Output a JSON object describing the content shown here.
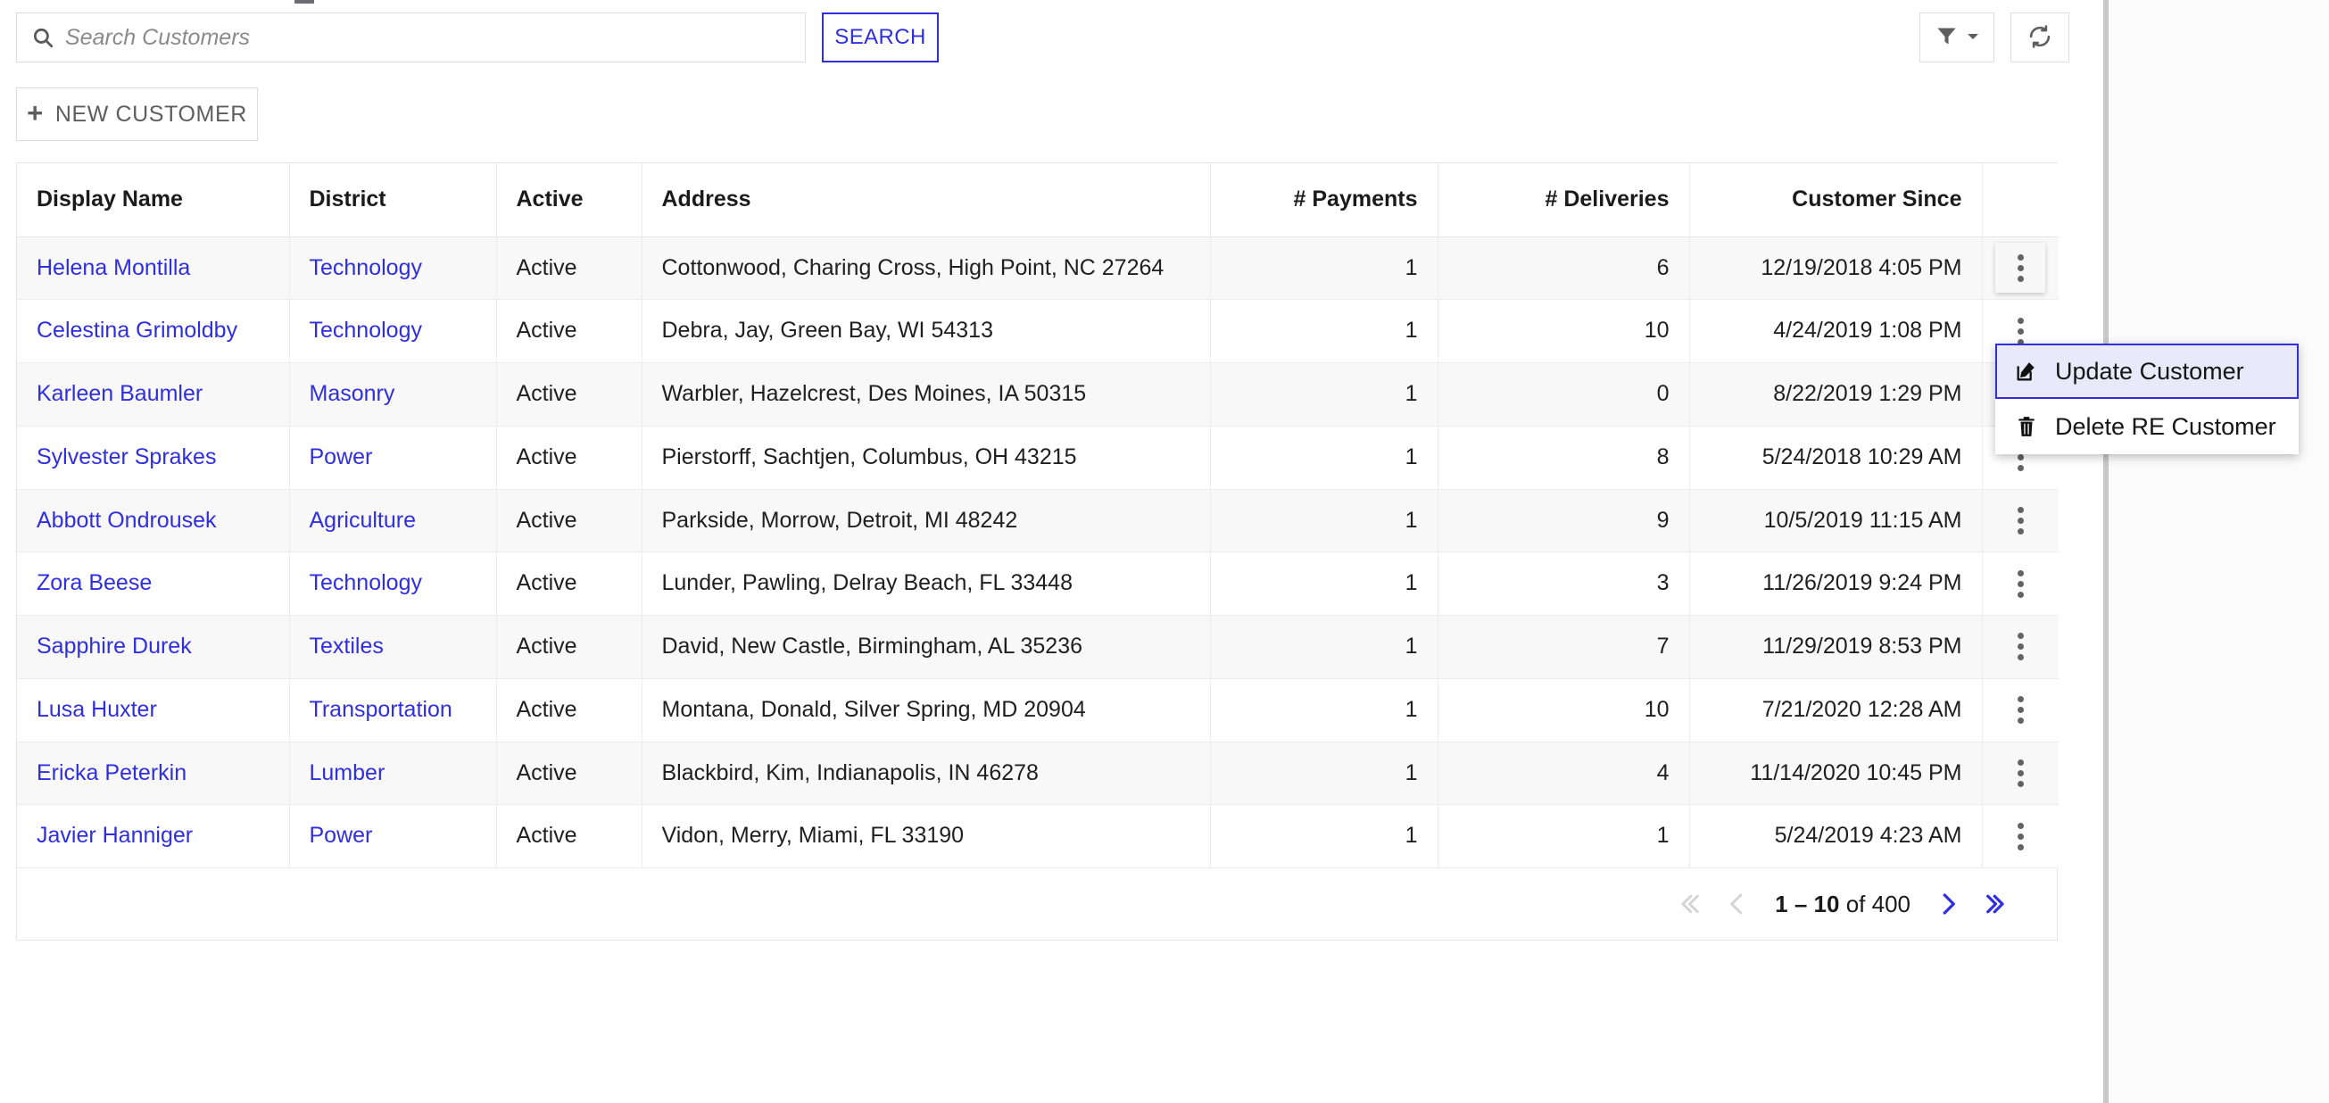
{
  "search": {
    "placeholder": "Search Customers",
    "value": "",
    "button_label": "SEARCH",
    "icon": "search-icon"
  },
  "toolbar": {
    "filter_icon": "filter-funnel-icon",
    "filter_caret_icon": "chevron-down-icon",
    "refresh_icon": "refresh-icon"
  },
  "new_customer": {
    "label": "NEW CUSTOMER",
    "icon": "plus-icon"
  },
  "table": {
    "columns": [
      {
        "label": "Display Name",
        "align": "left"
      },
      {
        "label": "District",
        "align": "left"
      },
      {
        "label": "Active",
        "align": "left"
      },
      {
        "label": "Address",
        "align": "left"
      },
      {
        "label": "# Payments",
        "align": "right"
      },
      {
        "label": "# Deliveries",
        "align": "right"
      },
      {
        "label": "Customer Since",
        "align": "right"
      },
      {
        "label": "",
        "align": "center"
      }
    ],
    "rows": [
      {
        "display_name": "Helena Montilla",
        "district": "Technology",
        "active": "Active",
        "address": "Cottonwood, Charing Cross, High Point, NC 27264",
        "payments": "1",
        "deliveries": "6",
        "customer_since": "12/19/2018 4:05 PM",
        "menu_open": true
      },
      {
        "display_name": "Celestina Grimoldby",
        "district": "Technology",
        "active": "Active",
        "address": "Debra, Jay, Green Bay, WI 54313",
        "payments": "1",
        "deliveries": "10",
        "customer_since": "4/24/2019 1:08 PM",
        "menu_open": false
      },
      {
        "display_name": "Karleen Baumler",
        "district": "Masonry",
        "active": "Active",
        "address": "Warbler, Hazelcrest, Des Moines, IA 50315",
        "payments": "1",
        "deliveries": "0",
        "customer_since": "8/22/2019 1:29 PM",
        "menu_open": false
      },
      {
        "display_name": "Sylvester Sprakes",
        "district": "Power",
        "active": "Active",
        "address": "Pierstorff, Sachtjen, Columbus, OH 43215",
        "payments": "1",
        "deliveries": "8",
        "customer_since": "5/24/2018 10:29 AM",
        "menu_open": false
      },
      {
        "display_name": "Abbott Ondrousek",
        "district": "Agriculture",
        "active": "Active",
        "address": "Parkside, Morrow, Detroit, MI 48242",
        "payments": "1",
        "deliveries": "9",
        "customer_since": "10/5/2019 11:15 AM",
        "menu_open": false
      },
      {
        "display_name": "Zora Beese",
        "district": "Technology",
        "active": "Active",
        "address": "Lunder, Pawling, Delray Beach, FL 33448",
        "payments": "1",
        "deliveries": "3",
        "customer_since": "11/26/2019 9:24 PM",
        "menu_open": false
      },
      {
        "display_name": "Sapphire Durek",
        "district": "Textiles",
        "active": "Active",
        "address": "David, New Castle, Birmingham, AL 35236",
        "payments": "1",
        "deliveries": "7",
        "customer_since": "11/29/2019 8:53 PM",
        "menu_open": false
      },
      {
        "display_name": "Lusa Huxter",
        "district": "Transportation",
        "active": "Active",
        "address": "Montana, Donald, Silver Spring, MD 20904",
        "payments": "1",
        "deliveries": "10",
        "customer_since": "7/21/2020 12:28 AM",
        "menu_open": false
      },
      {
        "display_name": "Ericka Peterkin",
        "district": "Lumber",
        "active": "Active",
        "address": "Blackbird, Kim, Indianapolis, IN 46278",
        "payments": "1",
        "deliveries": "4",
        "customer_since": "11/14/2020 10:45 PM",
        "menu_open": false
      },
      {
        "display_name": "Javier Hanniger",
        "district": "Power",
        "active": "Active",
        "address": "Vidon, Merry, Miami, FL 33190",
        "payments": "1",
        "deliveries": "1",
        "customer_since": "5/24/2019 4:23 AM",
        "menu_open": false
      }
    ]
  },
  "context_menu": {
    "items": [
      {
        "label": "Update Customer",
        "icon": "edit-pencil-icon",
        "focused": true
      },
      {
        "label": "Delete RE Customer",
        "icon": "trash-icon",
        "focused": false
      }
    ]
  },
  "paginator": {
    "first_label": "«",
    "prev_label": "‹",
    "next_label": "›",
    "last_label": "»",
    "range_start": "1",
    "range_end": "10",
    "of_word": "of",
    "total": "400",
    "range_text": "1 – 10 of 400"
  },
  "colors": {
    "link": "#2f2fe0",
    "accent": "#2f2fe0",
    "menu_focus_bg": "#e9e9fa",
    "row_alt_bg": "#f8f8f8",
    "border": "#e4e4e4",
    "text": "#1f1f1f",
    "muted": "#5e5e5e"
  }
}
